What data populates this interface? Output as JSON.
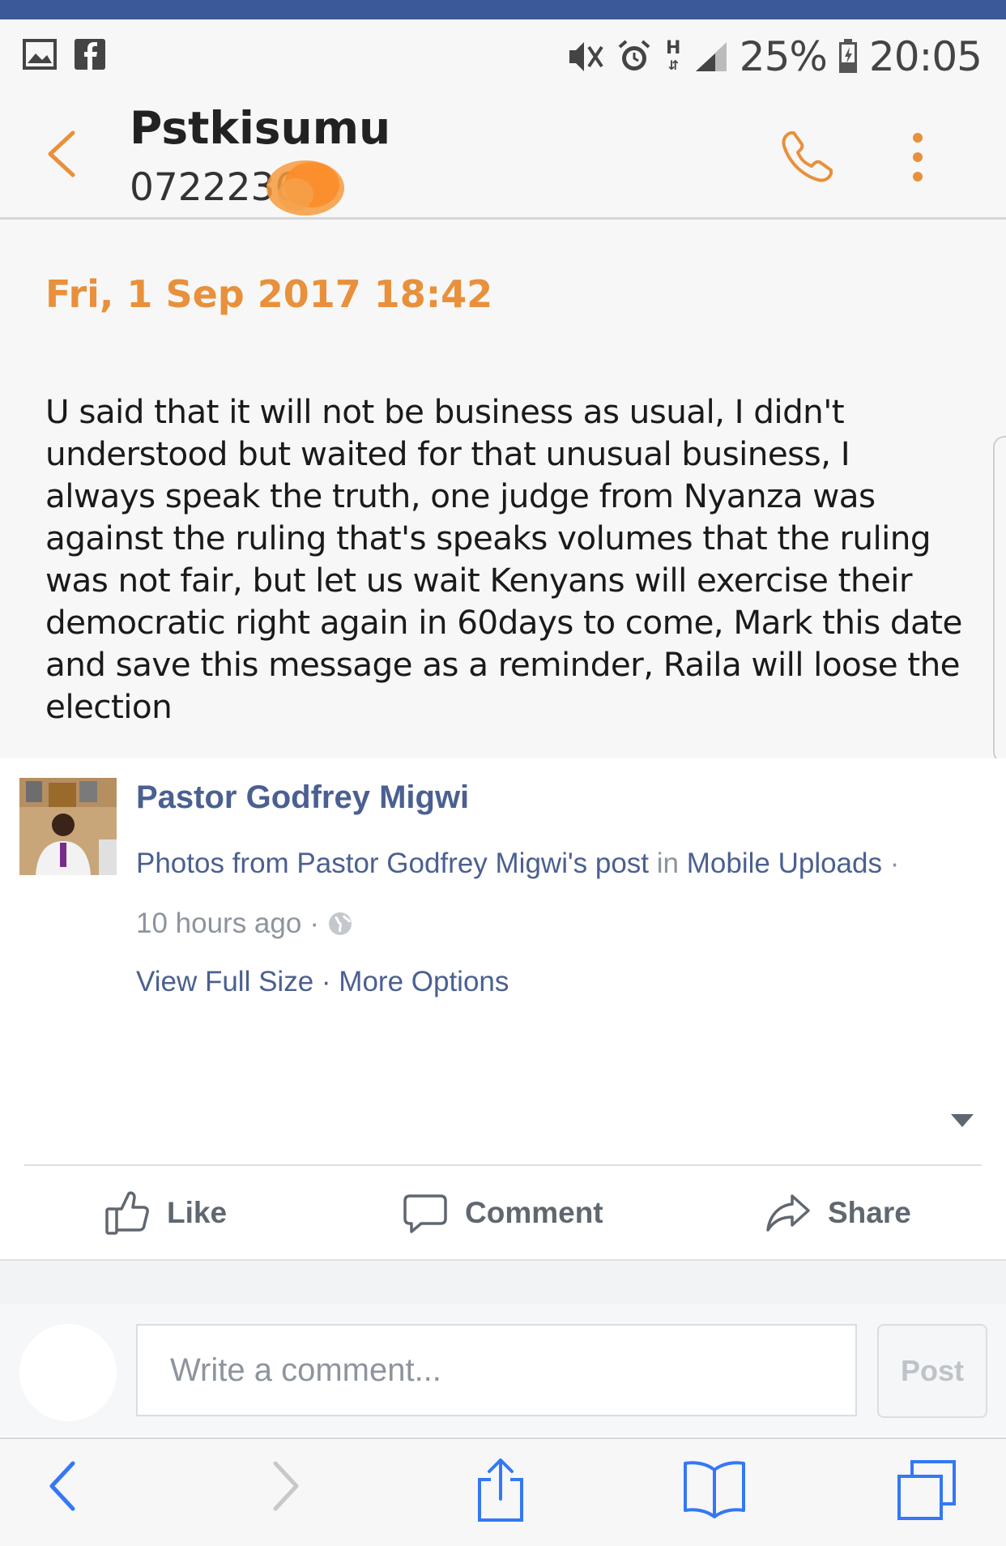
{
  "status_bar": {
    "battery": "25%",
    "time": "20:05",
    "network": "H"
  },
  "sms": {
    "contact_name": "Pstkisumu",
    "contact_number": "0722236",
    "date": "Fri, 1 Sep 2017 18:42",
    "message": "U said that it will not be business as usual, I didn't understood but waited for that unusual business, I always speak the truth, one judge from Nyanza was against the ruling that's speaks volumes that the ruling was not fair, but let us wait Kenyans will exercise their democratic right again in 60days to come, Mark this date and save this message as a reminder, Raila will loose the election"
  },
  "post": {
    "author": "Pastor Godfrey Migwi",
    "photos_prefix": "Photos from Pastor Godfrey Migwi's post",
    "photos_in": "in",
    "album": "Mobile Uploads",
    "dot": "·",
    "time_ago": "10 hours ago",
    "view_full_size": "View Full Size",
    "more_options": "More Options"
  },
  "actions": {
    "like": "Like",
    "comment": "Comment",
    "share": "Share"
  },
  "comment_box": {
    "placeholder": "Write a comment...",
    "post_label": "Post"
  },
  "colors": {
    "facebook_blue": "#3b5998",
    "sms_accent": "#e8903b",
    "link": "#4b6091",
    "safari_blue": "#3478f6"
  }
}
